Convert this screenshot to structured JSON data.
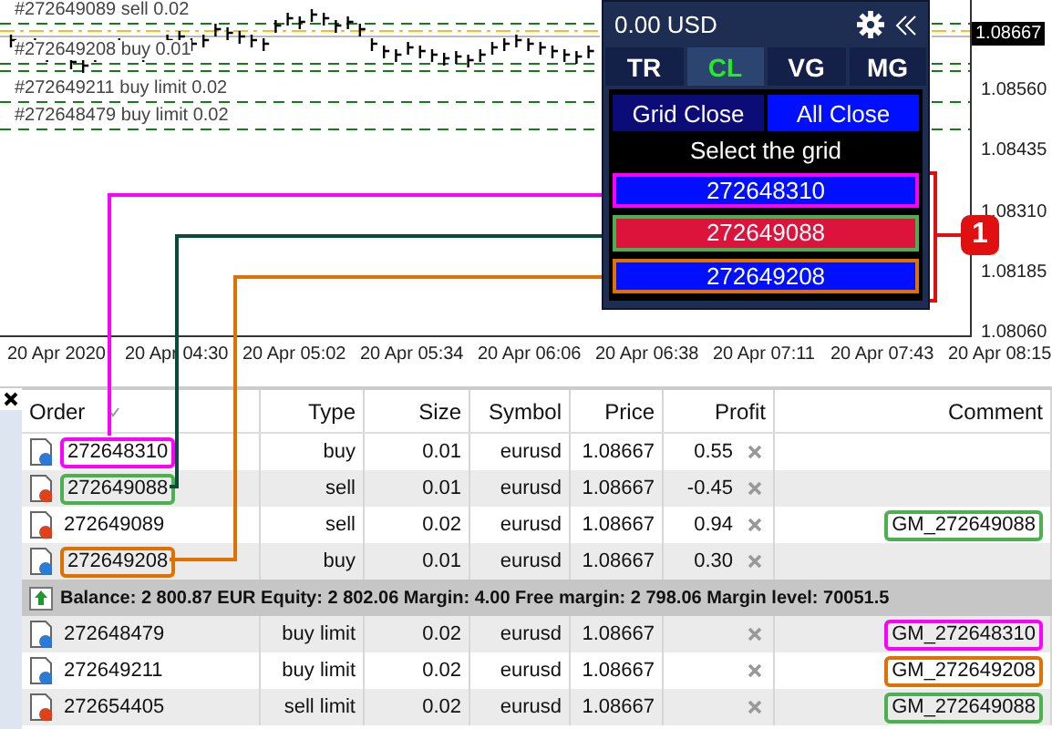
{
  "chart": {
    "order_lines": [
      {
        "label": "#272649089 sell 0.02"
      },
      {
        "label": "#272649208 buy 0.01"
      },
      {
        "label": "#272649211 buy limit 0.02"
      },
      {
        "label": "#272648479 buy limit 0.02"
      }
    ],
    "price_axis": [
      {
        "label": "1.08667",
        "current": true
      },
      {
        "label": "1.08560",
        "current": false
      },
      {
        "label": "1.08435",
        "current": false
      },
      {
        "label": "1.08310",
        "current": false
      },
      {
        "label": "1.08185",
        "current": false
      },
      {
        "label": "1.08060",
        "current": false
      }
    ],
    "time_axis": [
      "20 Apr 2020",
      "20 Apr 04:30",
      "20 Apr 05:02",
      "20 Apr 05:34",
      "20 Apr 06:06",
      "20 Apr 06:38",
      "20 Apr 07:11",
      "20 Apr 07:43",
      "20 Apr 08:15"
    ]
  },
  "panel": {
    "balance": "0.00 USD",
    "tabs": [
      {
        "label": "TR",
        "selected": false
      },
      {
        "label": "CL",
        "selected": true
      },
      {
        "label": "VG",
        "selected": false
      },
      {
        "label": "MG",
        "selected": false
      }
    ],
    "actions": [
      {
        "label": "Grid Close",
        "kind": "secondary"
      },
      {
        "label": "All Close",
        "kind": "primary"
      }
    ],
    "prompt": "Select the grid",
    "grids": [
      {
        "label": "272648310",
        "color": "#ff00ff",
        "selected": false
      },
      {
        "label": "272649088",
        "color": "#4caf50",
        "selected": true
      },
      {
        "label": "272649208",
        "color": "#e07000",
        "selected": false
      }
    ]
  },
  "callout": {
    "label": "1"
  },
  "table": {
    "columns": [
      "Order",
      "Type",
      "Size",
      "Symbol",
      "Price",
      "Profit",
      "Comment"
    ],
    "positions": [
      {
        "kind": "buy",
        "order": {
          "text": "272648310",
          "color": "#ff00ff"
        },
        "type": "buy",
        "size": "0.01",
        "symbol": "eurusd",
        "price": "1.08667",
        "profit": "0.55"
      },
      {
        "kind": "sell",
        "order": {
          "text": "272649088",
          "color": "#4caf50"
        },
        "type": "sell",
        "size": "0.01",
        "symbol": "eurusd",
        "price": "1.08667",
        "profit": "-0.45"
      },
      {
        "kind": "sell",
        "order": {
          "text": "272649089"
        },
        "type": "sell",
        "size": "0.02",
        "symbol": "eurusd",
        "price": "1.08667",
        "profit": "0.94",
        "comment": {
          "text": "GM_272649088",
          "color": "#4caf50"
        }
      },
      {
        "kind": "buy",
        "order": {
          "text": "272649208",
          "color": "#e07000"
        },
        "type": "buy",
        "size": "0.01",
        "symbol": "eurusd",
        "price": "1.08667",
        "profit": "0.30"
      }
    ],
    "summary": "Balance: 2 800.87 EUR  Equity: 2 802.06  Margin: 4.00  Free margin: 2 798.06  Margin level: 70051.5",
    "pending_orders": [
      {
        "kind": "buy",
        "order": {
          "text": "272648479"
        },
        "type": "buy limit",
        "size": "0.02",
        "symbol": "eurusd",
        "price": "1.08667",
        "comment": {
          "text": "GM_272648310",
          "color": "#ff00ff"
        }
      },
      {
        "kind": "buy",
        "order": {
          "text": "272649211"
        },
        "type": "buy limit",
        "size": "0.02",
        "symbol": "eurusd",
        "price": "1.08667",
        "comment": {
          "text": "GM_272649208",
          "color": "#e07000"
        }
      },
      {
        "kind": "sell",
        "order": {
          "text": "272654405"
        },
        "type": "sell limit",
        "size": "0.02",
        "symbol": "eurusd",
        "price": "1.08667",
        "comment": {
          "text": "GM_272649088",
          "color": "#4caf50"
        }
      }
    ]
  }
}
